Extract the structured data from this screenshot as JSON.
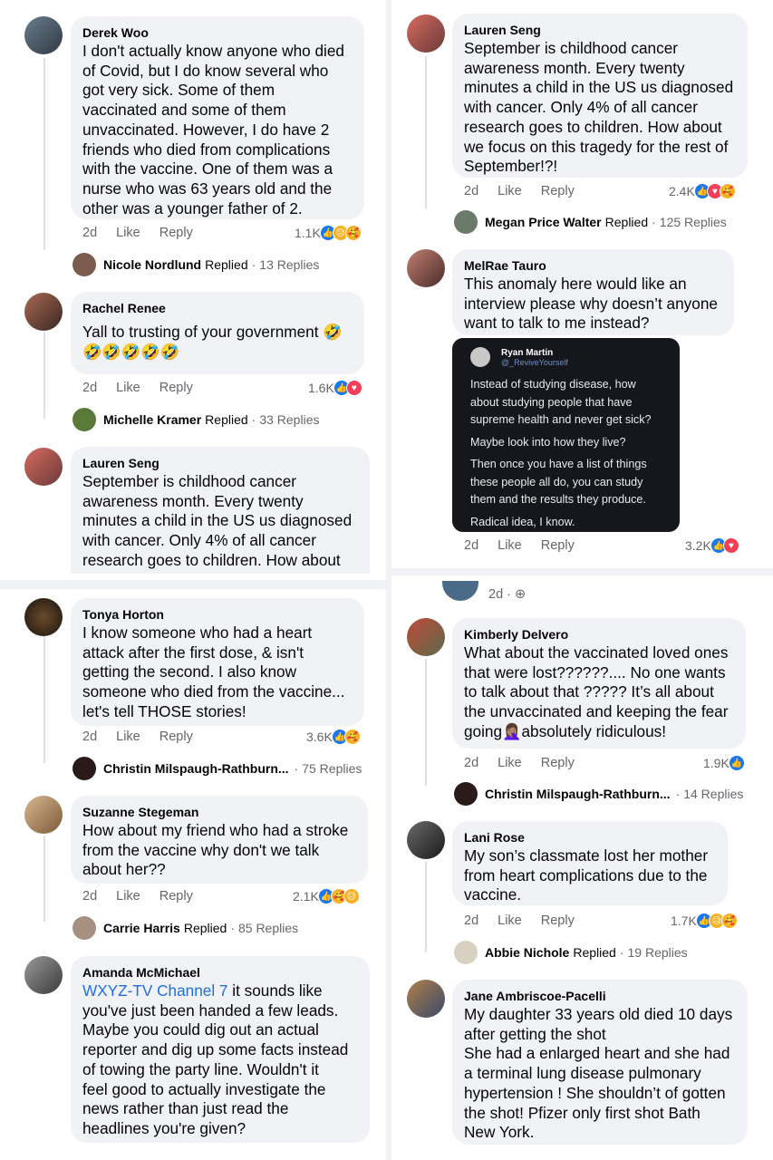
{
  "react_icons": {
    "like": "thumbs-up-icon",
    "love": "heart-icon",
    "care": "care-hug-icon",
    "sad": "sad-face-icon"
  },
  "colors": {
    "bubble": "#f0f2f5",
    "link": "#216fdb",
    "like": "#1877f2",
    "love": "#f33e58",
    "care": "#f7b125"
  },
  "actions": {
    "time": "2d",
    "like": "Like",
    "reply": "Reply",
    "replied": "Replied",
    "sep": "·"
  },
  "top_left": {
    "c1": {
      "name": "Derek Woo",
      "text": "I don't actually know anyone who died\nof Covid, but I do know several who\ngot very sick. Some of them\nvaccinated and some of them\nunvaccinated. However, I do have 2\nfriends who died from complications\nwith the vaccine. One of them was a\nnurse who was 63 years old and the\nother was a younger father of 2.",
      "count": "1.1K",
      "reply_name": "Nicole Nordlund",
      "reply_count": "13 Replies"
    },
    "c2": {
      "name": "Rachel Renee",
      "text": "Yall to trusting of your government 🤣\n🤣🤣🤣🤣🤣",
      "count": "1.6K",
      "reply_name": "Michelle Kramer",
      "reply_count": "33 Replies"
    },
    "c3": {
      "name": "Lauren Seng",
      "text": "September is childhood cancer\nawareness month. Every twenty\nminutes a child in the US us diagnosed\nwith cancer. Only 4% of all cancer\nresearch goes to children. How about"
    }
  },
  "top_right": {
    "c1": {
      "name": "Lauren Seng",
      "text": "September is childhood cancer\nawareness month. Every twenty\nminutes a child in the US us diagnosed\nwith cancer. Only 4% of all cancer\nresearch goes to children. How about\nwe focus on this tragedy for the rest of\nSeptember!?!",
      "count": "2.4K",
      "reply_name": "Megan Price Walter",
      "reply_count": "125 Replies"
    },
    "c2": {
      "name": "MelRae Tauro",
      "text": "This anomaly here would like an\ninterview please why doesn’t anyone\nwant to talk to me instead?",
      "count": "3.2K",
      "embed": {
        "name": "Ryan Martin",
        "handle": "@_ReviveYourself",
        "p1": "Instead of studying disease, how about studying people that have supreme health and never get sick?",
        "p2": "Maybe look into how they live?",
        "p3": "Then once you have a list of things these people all do, you can study them and the results they produce.",
        "p4": "Radical idea, I know."
      }
    }
  },
  "bottom_left": {
    "c1": {
      "name": "Tonya Horton",
      "text": "I know someone who had a heart\nattack after the first dose, & isn't\ngetting the second. I also know\nsomeone who died from the vaccine...\nlet's tell THOSE stories!",
      "count": "3.6K",
      "reply_name": "Christin Milspaugh-Rathburn...",
      "reply_count": "75 Replies"
    },
    "c2": {
      "name": "Suzanne Stegeman",
      "text": "How about my friend who had a stroke\nfrom the vaccine why don't we talk\nabout her??",
      "count": "2.1K",
      "reply_name": "Carrie Harris",
      "reply_count": "85 Replies"
    },
    "c3": {
      "name": "Amanda McMichael",
      "link": "WXYZ-TV Channel 7",
      "text": " it sounds like\nyou've just been handed a few leads.\nMaybe you could dig out an actual\nreporter and dig up some facts instead\nof towing the party line. Wouldn't it\nfeel good to actually investigate the\nnews rather than just read the\nheadlines you're given?"
    }
  },
  "bottom_right": {
    "post_time": "2d",
    "c1": {
      "name": "Kimberly Delvero",
      "text": "What about the vaccinated loved ones\nthat were lost??????.... No one wants\nto talk about that ????? It’s all about\nthe unvaccinated and keeping the fear\ngoing🤦🏽‍♀️absolutely ridiculous!",
      "count": "1.9K",
      "reply_name": "Christin Milspaugh-Rathburn...",
      "reply_count": "14 Replies"
    },
    "c2": {
      "name": "Lani Rose",
      "text": "My son’s classmate lost her mother\nfrom heart complications due to the\nvaccine.",
      "count": "1.7K",
      "reply_name": "Abbie Nichole",
      "reply_count": "19 Replies"
    },
    "c3": {
      "name": "Jane Ambriscoe-Pacelli",
      "text": "My daughter 33 years old died 10 days\nafter getting the shot\nShe had a enlarged heart and she had\na terminal lung disease pulmonary\nhypertension ! She shouldn’t of gotten\nthe shot! Pfizer only first shot Bath\nNew York."
    }
  }
}
